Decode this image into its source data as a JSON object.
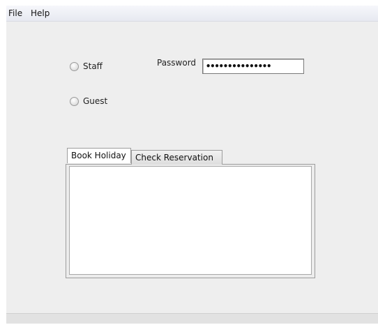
{
  "menubar": {
    "items": [
      {
        "label": "File"
      },
      {
        "label": "Help"
      }
    ]
  },
  "login": {
    "role_options": [
      {
        "label": "Staff",
        "selected": false
      },
      {
        "label": "Guest",
        "selected": false
      }
    ],
    "password_label": "Password",
    "password_value": "•••••••••••••••"
  },
  "tabs": [
    {
      "label": "Book Holiday",
      "active": true
    },
    {
      "label": "Check Reservation",
      "active": false
    }
  ]
}
